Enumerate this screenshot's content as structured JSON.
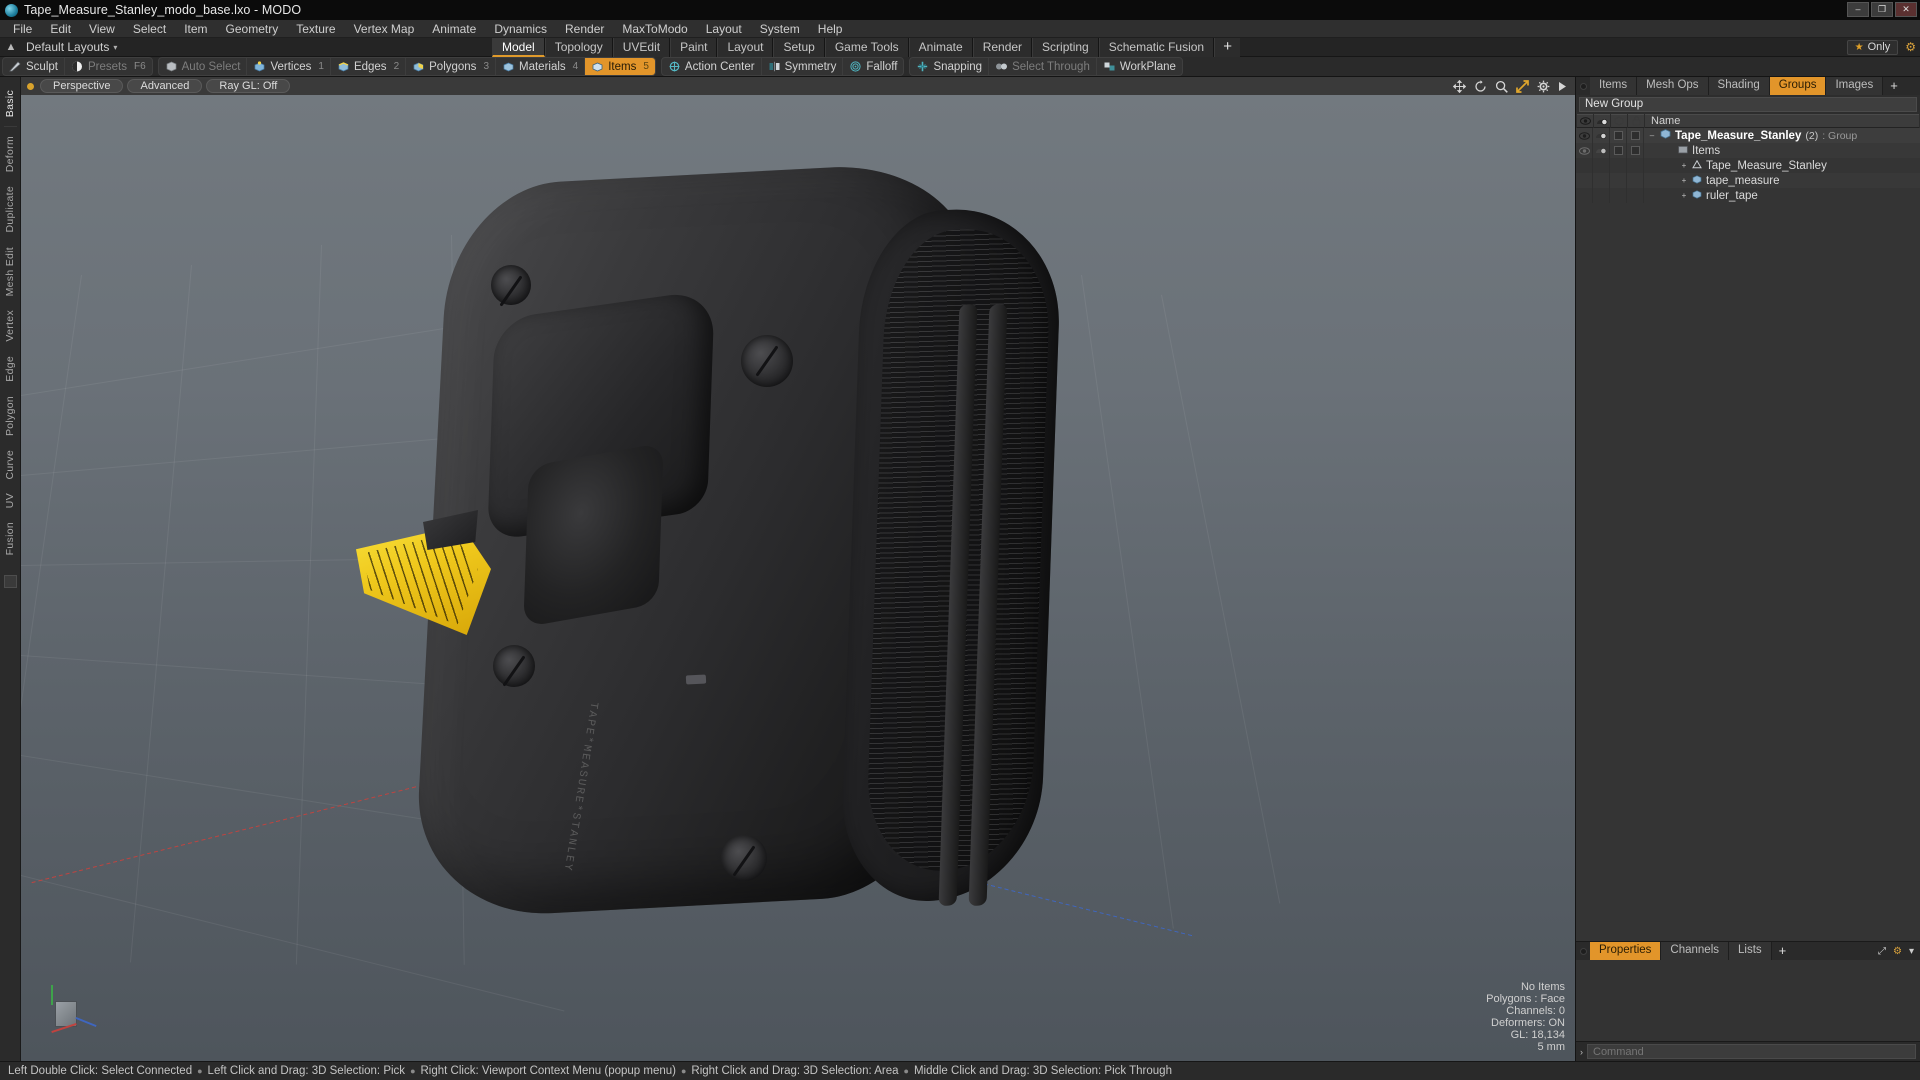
{
  "window": {
    "title": "Tape_Measure_Stanley_modo_base.lxo - MODO",
    "logo_icon": "modo-logo-icon",
    "minimize": "–",
    "maximize": "❐",
    "close": "✕"
  },
  "menubar": {
    "items": [
      "File",
      "Edit",
      "View",
      "Select",
      "Item",
      "Geometry",
      "Texture",
      "Vertex Map",
      "Animate",
      "Dynamics",
      "Render",
      "MaxToModo",
      "Layout",
      "System",
      "Help"
    ]
  },
  "layoutbar": {
    "home_icon": "home-icon",
    "label": "Default Layouts",
    "caret": "▾",
    "tabs": [
      {
        "label": "Model",
        "active": true
      },
      {
        "label": "Topology",
        "active": false
      },
      {
        "label": "UVEdit",
        "active": false
      },
      {
        "label": "Paint",
        "active": false
      },
      {
        "label": "Layout",
        "active": false
      },
      {
        "label": "Setup",
        "active": false
      },
      {
        "label": "Game Tools",
        "active": false
      },
      {
        "label": "Animate",
        "active": false
      },
      {
        "label": "Render",
        "active": false
      },
      {
        "label": "Scripting",
        "active": false
      },
      {
        "label": "Schematic Fusion",
        "active": false
      }
    ],
    "add_tab": "+",
    "only_label": "Only",
    "star_icon": "star-icon",
    "gear_icon": "gear-icon"
  },
  "modebar": {
    "groups": [
      {
        "name": "sculpt-presets",
        "buttons": [
          {
            "label": "Sculpt",
            "icon": "sculpt-brush-icon",
            "state": "normal",
            "num": ""
          },
          {
            "label": "Presets",
            "icon": "presets-sphere-icon",
            "state": "dim",
            "num": "F6"
          }
        ]
      },
      {
        "name": "selection-modes",
        "buttons": [
          {
            "label": "Auto Select",
            "icon": "auto-select-icon",
            "state": "dim",
            "num": ""
          },
          {
            "label": "Vertices",
            "icon": "vertices-icon",
            "state": "normal",
            "num": "1"
          },
          {
            "label": "Edges",
            "icon": "edges-icon",
            "state": "normal",
            "num": "2"
          },
          {
            "label": "Polygons",
            "icon": "polygons-icon",
            "state": "normal",
            "num": "3"
          },
          {
            "label": "Materials",
            "icon": "materials-icon",
            "state": "normal",
            "num": "4"
          },
          {
            "label": "Items",
            "icon": "items-icon",
            "state": "selected",
            "num": "5"
          }
        ]
      },
      {
        "name": "action-center",
        "buttons": [
          {
            "label": "Action Center",
            "icon": "action-center-icon",
            "state": "normal",
            "num": ""
          },
          {
            "label": "Symmetry",
            "icon": "symmetry-icon",
            "state": "normal",
            "num": ""
          },
          {
            "label": "Falloff",
            "icon": "falloff-icon",
            "state": "normal",
            "num": ""
          }
        ]
      },
      {
        "name": "snapping-workplane",
        "buttons": [
          {
            "label": "Snapping",
            "icon": "snapping-icon",
            "state": "normal",
            "num": ""
          },
          {
            "label": "Select Through",
            "icon": "select-through-icon",
            "state": "dim",
            "num": ""
          },
          {
            "label": "WorkPlane",
            "icon": "workplane-icon",
            "state": "normal",
            "num": ""
          }
        ]
      }
    ]
  },
  "lefttabs": {
    "items": [
      "Basic",
      "Deform",
      "Duplicate",
      "Mesh Edit",
      "Vertex",
      "Edge",
      "Polygon",
      "Curve",
      "UV",
      "Fusion"
    ],
    "active": "Basic"
  },
  "viewport": {
    "header": {
      "view_label": "Perspective",
      "shading_label": "Advanced",
      "raygl_label": "Ray GL: Off",
      "icons": [
        "move-icon",
        "rotate-icon",
        "zoom-icon",
        "fit-icon",
        "gear-icon",
        "expand-arrow-icon"
      ]
    },
    "model_text": "TAPE*MEASURE*STANLEY",
    "stats": {
      "selection": "No Items",
      "polygons": "Polygons : Face",
      "channels": "Channels: 0",
      "deformers": "Deformers: ON",
      "gl": "GL: 18,134",
      "grid": "5 mm"
    },
    "gizmo": "axis-gizmo-icon"
  },
  "rightpanel": {
    "tabs": [
      {
        "label": "Items",
        "active": false
      },
      {
        "label": "Mesh Ops",
        "active": false
      },
      {
        "label": "Shading",
        "active": false
      },
      {
        "label": "Groups",
        "active": true
      },
      {
        "label": "Images",
        "active": false
      }
    ],
    "add_tab": "+",
    "group_name": "New Group",
    "columns": {
      "eye_icon": "visibility-eye-icon",
      "render_icon": "render-toggle-icon",
      "shape_icon": "item-shape-icon",
      "lock_icon": "lock-icon",
      "name_header": "Name"
    },
    "tree": [
      {
        "level": 0,
        "expander": "–",
        "name": "Tape_Measure_Stanley",
        "bold": true,
        "count": "(2)",
        "meta": ": Group",
        "selected": true,
        "icon": "group-icon"
      },
      {
        "level": 1,
        "expander": "",
        "name": "Items",
        "bold": false,
        "count": "",
        "meta": "",
        "selected": false,
        "icon": "items-folder-icon"
      },
      {
        "level": 2,
        "expander": "+",
        "name": "Tape_Measure_Stanley",
        "bold": false,
        "count": "",
        "meta": "",
        "selected": false,
        "icon": "locator-icon"
      },
      {
        "level": 2,
        "expander": "+",
        "name": "tape_measure",
        "bold": false,
        "count": "",
        "meta": "",
        "selected": false,
        "icon": "mesh-icon"
      },
      {
        "level": 2,
        "expander": "+",
        "name": "ruler_tape",
        "bold": false,
        "count": "",
        "meta": "",
        "selected": false,
        "icon": "mesh-icon"
      }
    ],
    "bottom_tabs": [
      {
        "label": "Properties",
        "active": true
      },
      {
        "label": "Channels",
        "active": false
      },
      {
        "label": "Lists",
        "active": false
      },
      {
        "label": "+",
        "active": false
      }
    ],
    "bottom_icons": [
      "expand-icon",
      "gear-icon",
      "caret-down-icon"
    ],
    "command": {
      "caret": "›",
      "placeholder": "Command"
    }
  },
  "statusbar": {
    "items": [
      "Left Double Click: Select Connected",
      "Left Click and Drag: 3D Selection: Pick",
      "Right Click: Viewport Context Menu (popup menu)",
      "Right Click and Drag: 3D Selection: Area",
      "Middle Click and Drag: 3D Selection: Pick Through"
    ],
    "separator": "●"
  },
  "colors": {
    "accent": "#e2952a",
    "axis_red": "#c0433f",
    "axis_blue": "#3f66c0",
    "axis_green": "#3ea34a",
    "tape_yellow": "#efc81c"
  }
}
